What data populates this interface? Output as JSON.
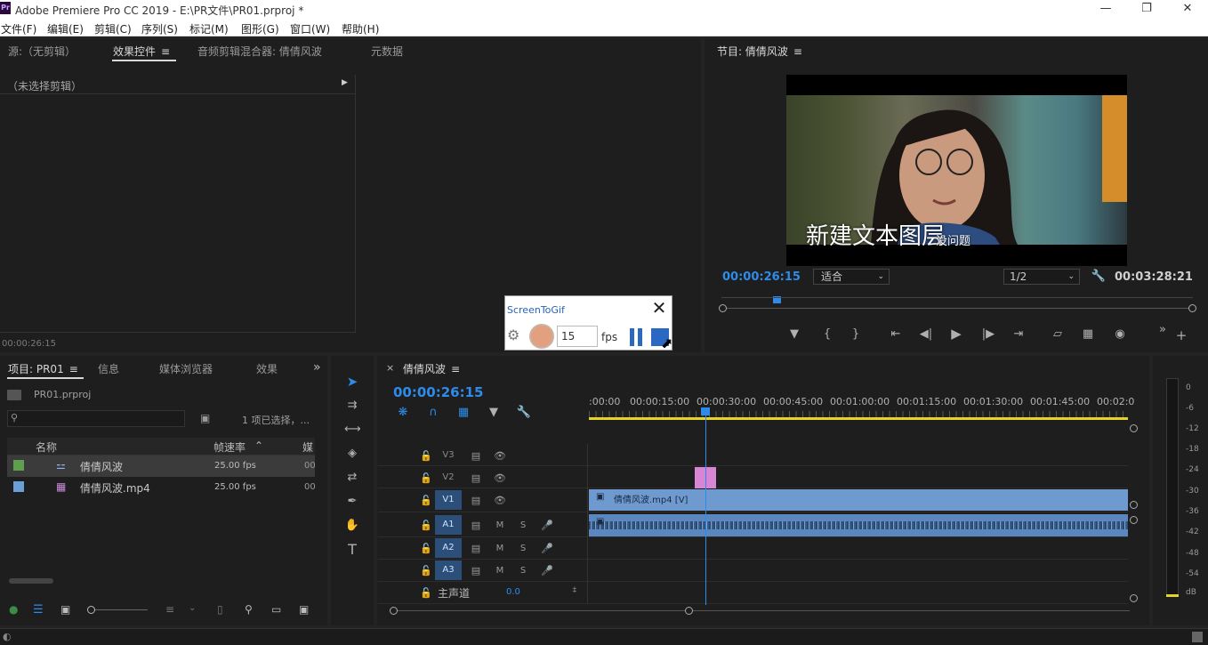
{
  "app": {
    "logo": "Pr",
    "title": "Adobe Premiere Pro CC 2019 - E:\\PR文件\\PR01.prproj *",
    "window_controls": [
      "minimize-icon",
      "restore-icon",
      "close-icon"
    ]
  },
  "menu": [
    "文件(F)",
    "编辑(E)",
    "剪辑(C)",
    "序列(S)",
    "标记(M)",
    "图形(G)",
    "窗口(W)",
    "帮助(H)"
  ],
  "source_panel": {
    "tabs": [
      "源:（无剪辑）",
      "效果控件",
      "音频剪辑混合器: 倩倩风波",
      "元数据"
    ],
    "active_tab": "效果控件",
    "no_clip_label": "（未选择剪辑）",
    "timecode": "00:00:26:15"
  },
  "program_monitor": {
    "title": "节目: 倩倩风波",
    "overlay_text": "新建文本图层",
    "overlay_text_2": "没问题",
    "timecode": "00:00:26:15",
    "fit_select": "适合",
    "resolution_select": "1/2",
    "duration": "00:03:28:21"
  },
  "screentogif": {
    "title": "ScreenToGif",
    "fps_value": "15",
    "fps_label": "fps"
  },
  "project_panel": {
    "tabs": [
      "项目: PR01",
      "信息",
      "媒体浏览器",
      "效果"
    ],
    "active_tab": "项目: PR01",
    "project_file": "PR01.prproj",
    "selection_info": "1 项已选择，...",
    "columns": [
      "名称",
      "帧速率",
      "媒"
    ],
    "items": [
      {
        "name": "倩倩风波",
        "fps": "25.00 fps",
        "media": "00",
        "color": "#5ea04d"
      },
      {
        "name": "倩倩风波.mp4",
        "fps": "25.00 fps",
        "media": "00",
        "color": "#6a9fd8"
      }
    ]
  },
  "timeline": {
    "sequence_name": "倩倩风波",
    "timecode": "00:00:26:15",
    "ruler_labels": [
      ":00:00",
      "00:00:15:00",
      "00:00:30:00",
      "00:00:45:00",
      "00:01:00:00",
      "00:01:15:00",
      "00:01:30:00",
      "00:01:45:00",
      "00:02:0"
    ],
    "video_tracks": [
      "V3",
      "V2",
      "V1"
    ],
    "audio_tracks": [
      "A1",
      "A2",
      "A3"
    ],
    "track_m": "M",
    "track_s": "S",
    "master_label": "主声道",
    "master_value": "0.0",
    "video_clip_label": "倩倩风波.mp4 [V]",
    "colors": {
      "video_clip": "#6f9ad0",
      "graphic_clip": "#d985d6",
      "audio_clip": "#5b87c0",
      "playhead": "#2d8ceb",
      "work_area": "#e5d22a"
    }
  },
  "audio_meter": {
    "labels": [
      "0",
      "-6",
      "-12",
      "-18",
      "-24",
      "-30",
      "-36",
      "-42",
      "-48",
      "-54",
      "dB"
    ]
  }
}
